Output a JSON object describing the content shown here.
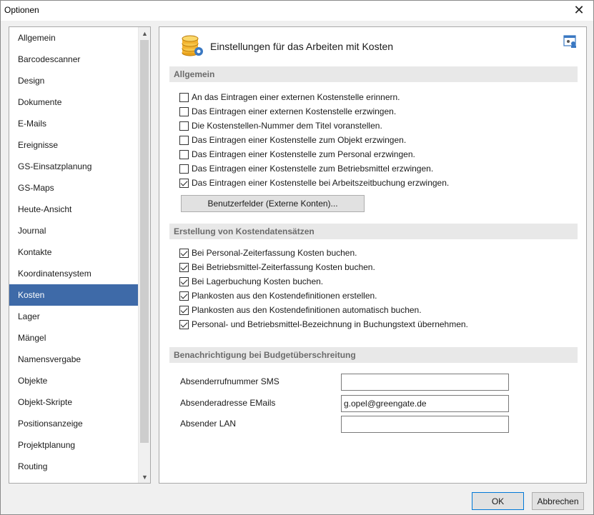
{
  "window": {
    "title": "Optionen",
    "close_glyph": "✕"
  },
  "sidebar": {
    "items": [
      {
        "label": "Allgemein"
      },
      {
        "label": "Barcodescanner"
      },
      {
        "label": "Design"
      },
      {
        "label": "Dokumente"
      },
      {
        "label": "E-Mails"
      },
      {
        "label": "Ereignisse"
      },
      {
        "label": "GS-Einsatzplanung"
      },
      {
        "label": "GS-Maps"
      },
      {
        "label": "Heute-Ansicht"
      },
      {
        "label": "Journal"
      },
      {
        "label": "Kontakte"
      },
      {
        "label": "Koordinatensystem"
      },
      {
        "label": "Kosten"
      },
      {
        "label": "Lager"
      },
      {
        "label": "Mängel"
      },
      {
        "label": "Namensvergabe"
      },
      {
        "label": "Objekte"
      },
      {
        "label": "Objekt-Skripte"
      },
      {
        "label": "Positionsanzeige"
      },
      {
        "label": "Projektplanung"
      },
      {
        "label": "Routing"
      }
    ],
    "active": "Kosten"
  },
  "header": {
    "title": "Einstellungen für das Arbeiten mit Kosten",
    "icon": "coins-gear-icon",
    "corner_icon": "user-settings-icon"
  },
  "allgemein": {
    "title": "Allgemein",
    "options": [
      {
        "label": "An das Eintragen einer externen Kostenstelle erinnern.",
        "checked": false
      },
      {
        "label": "Das Eintragen einer externen Kostenstelle erzwingen.",
        "checked": false
      },
      {
        "label": "Die Kostenstellen-Nummer dem Titel voranstellen.",
        "checked": false
      },
      {
        "label": "Das Eintragen einer Kostenstelle zum Objekt erzwingen.",
        "checked": false
      },
      {
        "label": "Das Eintragen einer Kostenstelle zum Personal erzwingen.",
        "checked": false
      },
      {
        "label": "Das Eintragen einer Kostenstelle zum Betriebsmittel erzwingen.",
        "checked": false
      },
      {
        "label": "Das Eintragen einer Kostenstelle bei Arbeitszeitbuchung erzwingen.",
        "checked": true
      }
    ],
    "button_label": "Benutzerfelder (Externe Konten)..."
  },
  "erstellung": {
    "title": "Erstellung von Kostendatensätzen",
    "options": [
      {
        "label": "Bei Personal-Zeiterfassung Kosten buchen.",
        "checked": true
      },
      {
        "label": "Bei Betriebsmittel-Zeiterfassung Kosten buchen.",
        "checked": true
      },
      {
        "label": "Bei Lagerbuchung Kosten buchen.",
        "checked": true
      },
      {
        "label": "Plankosten aus den Kostendefinitionen erstellen.",
        "checked": true
      },
      {
        "label": "Plankosten aus den Kostendefinitionen automatisch buchen.",
        "checked": true
      },
      {
        "label": "Personal- und Betriebsmittel-Bezeichnung in Buchungstext übernehmen.",
        "checked": true
      }
    ]
  },
  "benachrichtigung": {
    "title": "Benachrichtigung bei Budgetüberschreitung",
    "fields": [
      {
        "label": "Absenderrufnummer SMS",
        "value": ""
      },
      {
        "label": "Absenderadresse EMails",
        "value": "g.opel@greengate.de"
      },
      {
        "label": "Absender LAN",
        "value": ""
      }
    ]
  },
  "footer": {
    "ok_label": "OK",
    "cancel_label": "Abbrechen"
  },
  "colors": {
    "active_item": "#3e6aa8",
    "section_header": "#e8e8e8",
    "section_text": "#6b6b6b"
  }
}
